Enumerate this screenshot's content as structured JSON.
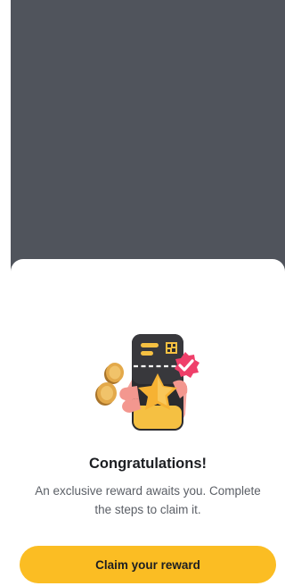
{
  "reward_modal": {
    "title": "Congratulations!",
    "message": "An exclusive reward awaits you. Complete the steps to claim it.",
    "cta_label": "Claim your reward"
  },
  "illustration": {
    "icon": "reward-ticket-phone-icon",
    "elements": [
      "gold-coin-icon",
      "star-icon",
      "check-badge-icon",
      "qr-code-icon"
    ]
  },
  "colors": {
    "backdrop": "#50545c",
    "sheet": "#ffffff",
    "accent": "#fbbd23",
    "title_text": "#1c1e22",
    "body_text": "#5b5f66",
    "badge": "#ef3f6a"
  }
}
